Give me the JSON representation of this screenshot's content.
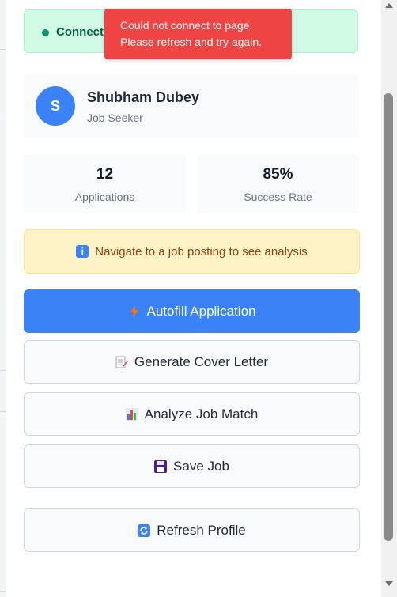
{
  "status": {
    "text": "Connected",
    "color": "#059669"
  },
  "toast": {
    "line1": "Could not connect to page.",
    "line2": "Please refresh and try again."
  },
  "profile": {
    "initial": "S",
    "name": "Shubham Dubey",
    "role": "Job Seeker"
  },
  "stats": [
    {
      "value": "12",
      "label": "Applications"
    },
    {
      "value": "85%",
      "label": "Success Rate"
    }
  ],
  "info": {
    "icon": "info-icon",
    "text": "Navigate to a job posting to see analysis"
  },
  "buttons": {
    "autofill": {
      "label": "Autofill Application",
      "icon": "lightning-icon"
    },
    "cover_letter": {
      "label": "Generate Cover Letter",
      "icon": "memo-icon"
    },
    "analyze": {
      "label": "Analyze Job Match",
      "icon": "bar-chart-icon"
    },
    "save": {
      "label": "Save Job",
      "icon": "floppy-disk-icon"
    },
    "refresh": {
      "label": "Refresh Profile",
      "icon": "refresh-icon"
    }
  },
  "colors": {
    "primary": "#3b82f6",
    "error": "#ef4444",
    "success_bg": "#d1fae5",
    "warning_bg": "#fef3c7"
  }
}
